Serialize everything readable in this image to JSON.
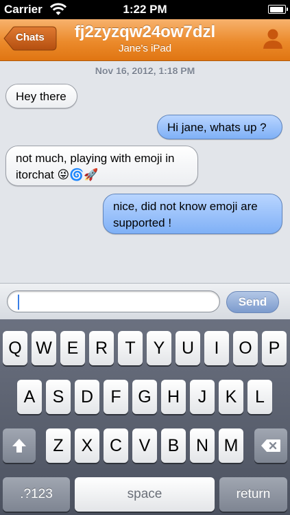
{
  "status_bar": {
    "carrier": "Carrier",
    "time": "1:22 PM"
  },
  "nav": {
    "back_label": "Chats",
    "title": "fj2zyzqw24ow7dzl",
    "subtitle": "Jane's iPad"
  },
  "conversation": {
    "timestamp": "Nov 16, 2012, 1:18 PM",
    "messages": [
      {
        "direction": "incoming",
        "text": "Hey there"
      },
      {
        "direction": "outgoing",
        "text": "Hi jane, whats up ?"
      },
      {
        "direction": "incoming",
        "line1": "not much, playing with emoji in",
        "line2": "itorchat 😜🌀🚀"
      },
      {
        "direction": "outgoing",
        "line1": "nice, did not know emoji are",
        "line2": "supported !"
      }
    ]
  },
  "composer": {
    "input_value": "",
    "send_label": "Send"
  },
  "keyboard": {
    "row1": [
      "Q",
      "W",
      "E",
      "R",
      "T",
      "Y",
      "U",
      "I",
      "O",
      "P"
    ],
    "row2": [
      "A",
      "S",
      "D",
      "F",
      "G",
      "H",
      "J",
      "K",
      "L"
    ],
    "row3": [
      "Z",
      "X",
      "C",
      "V",
      "B",
      "N",
      "M"
    ],
    "mode_label": ".?123",
    "space_label": "space",
    "return_label": "return"
  },
  "colors": {
    "nav_orange": "#eb8a2b",
    "outgoing_bubble": "#9cc3fb",
    "send_blue": "#8ea8d6"
  }
}
